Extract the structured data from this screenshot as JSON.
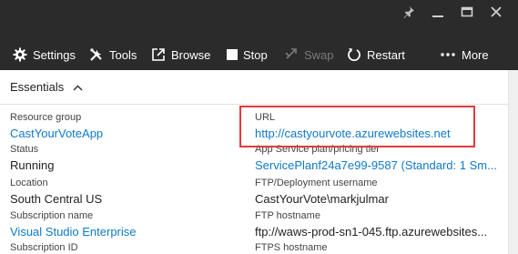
{
  "window": {
    "pin_icon": "pin-icon",
    "maximize_icon": "maximize-icon",
    "close_icon": "close-icon"
  },
  "toolbar": {
    "settings": "Settings",
    "tools": "Tools",
    "browse": "Browse",
    "stop": "Stop",
    "swap": "Swap",
    "restart": "Restart",
    "more": "More"
  },
  "essentials": {
    "title": "Essentials"
  },
  "fields": {
    "resource_group": {
      "label": "Resource group",
      "value": "CastYourVoteApp"
    },
    "status": {
      "label": "Status",
      "value": "Running"
    },
    "location": {
      "label": "Location",
      "value": "South Central US"
    },
    "subscription_name": {
      "label": "Subscription name",
      "value": "Visual Studio Enterprise"
    },
    "subscription_id": {
      "label": "Subscription ID"
    },
    "url": {
      "label": "URL",
      "value": "http://castyourvote.azurewebsites.net"
    },
    "app_service_plan": {
      "label": "App Service plan/pricing tier",
      "value": "ServicePlanf24a7e99-9587 (Standard: 1 Sm..."
    },
    "ftp_username": {
      "label": "FTP/Deployment username",
      "value": "CastYourVote\\markjulmar"
    },
    "ftp_hostname": {
      "label": "FTP hostname",
      "value": "ftp://waws-prod-sn1-045.ftp.azurewebsites..."
    },
    "ftps_hostname": {
      "label": "FTPS hostname"
    }
  },
  "colors": {
    "header_bg": "#2b2b2b",
    "link": "#0f7ac7",
    "highlight": "#e23b3b"
  }
}
